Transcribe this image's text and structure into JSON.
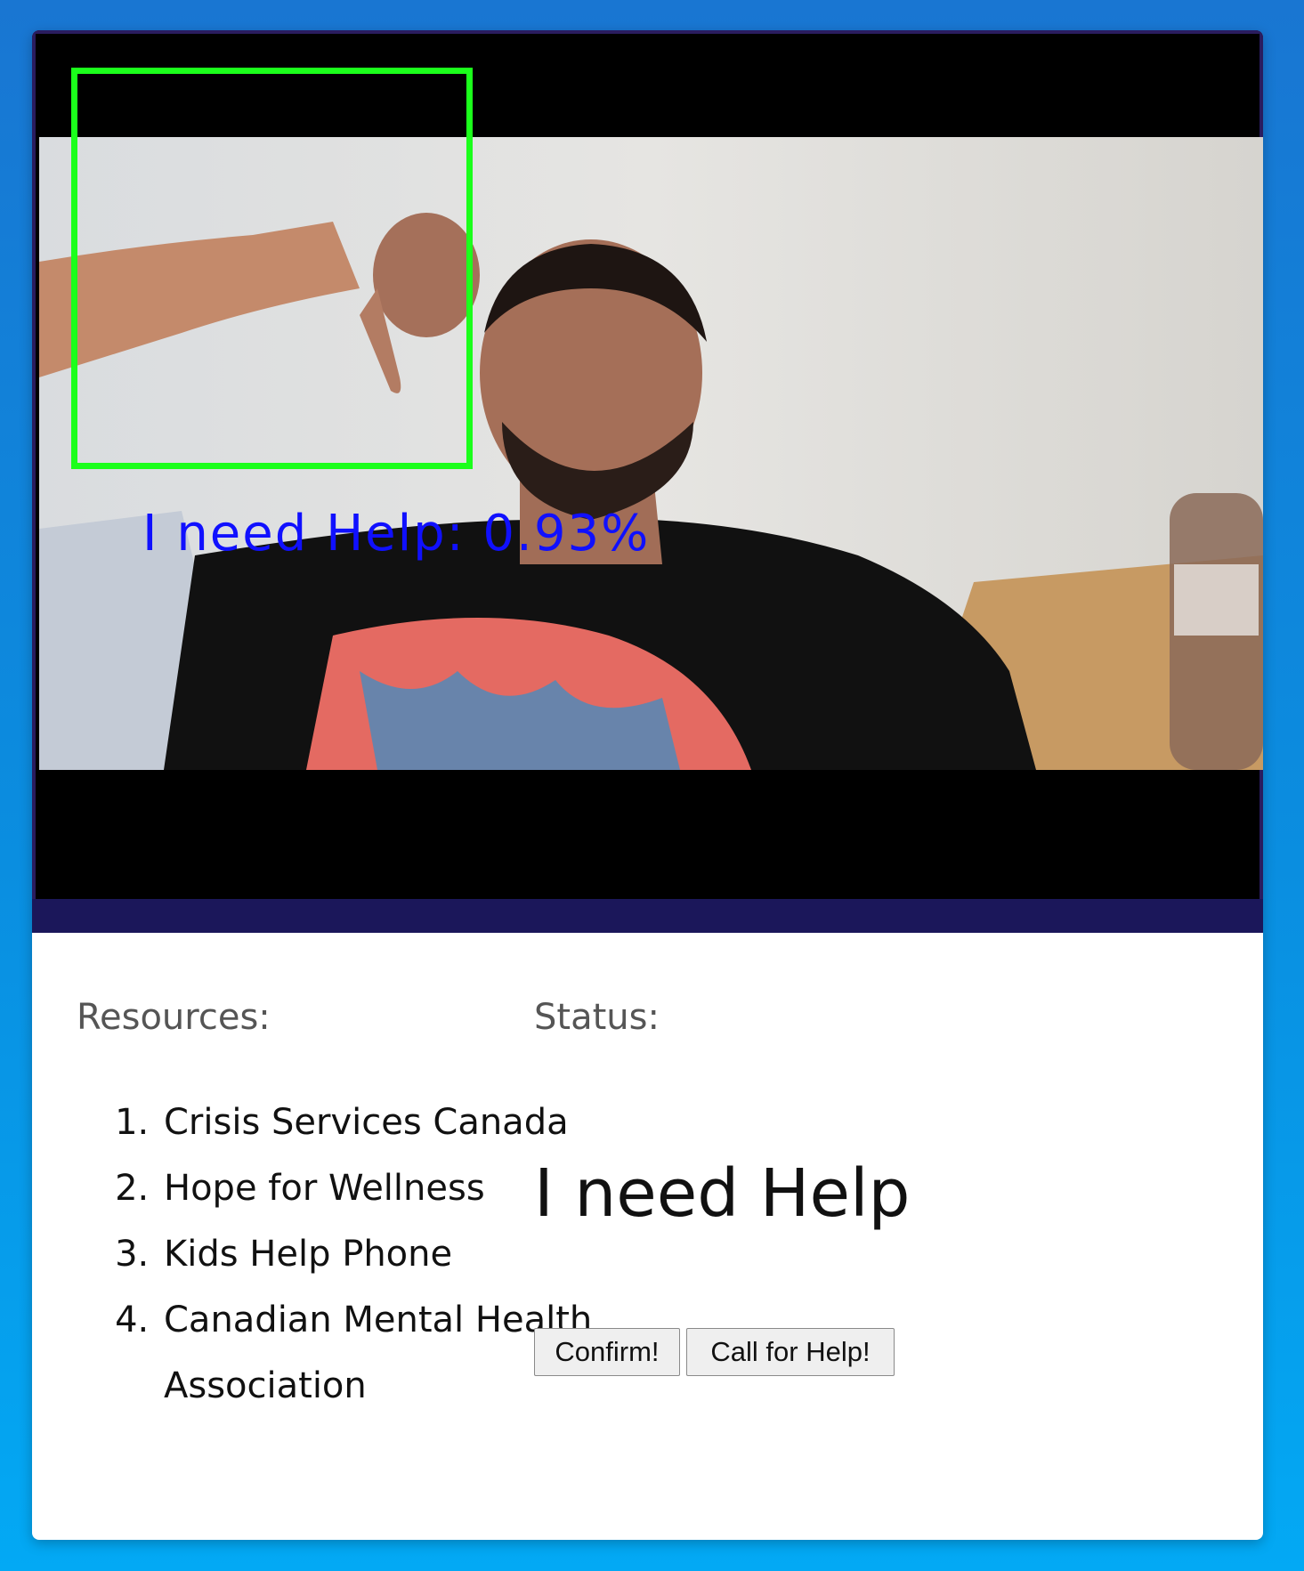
{
  "video": {
    "detection_label": "I need Help: 0.93%",
    "box_color": "#1bff1b",
    "label_color": "#1010ff"
  },
  "resources": {
    "heading": "Resources:",
    "items": [
      "Crisis Services Canada",
      "Hope for Wellness",
      "Kids Help Phone",
      "Canadian Mental Health Association"
    ]
  },
  "status": {
    "heading": "Status:",
    "value": "I need Help"
  },
  "buttons": {
    "confirm_label": "Confirm!",
    "call_label": "Call for Help!"
  },
  "colors": {
    "background_top": "#1976d2",
    "background_bottom": "#03a9f4",
    "frame_strip": "#1b175a"
  }
}
